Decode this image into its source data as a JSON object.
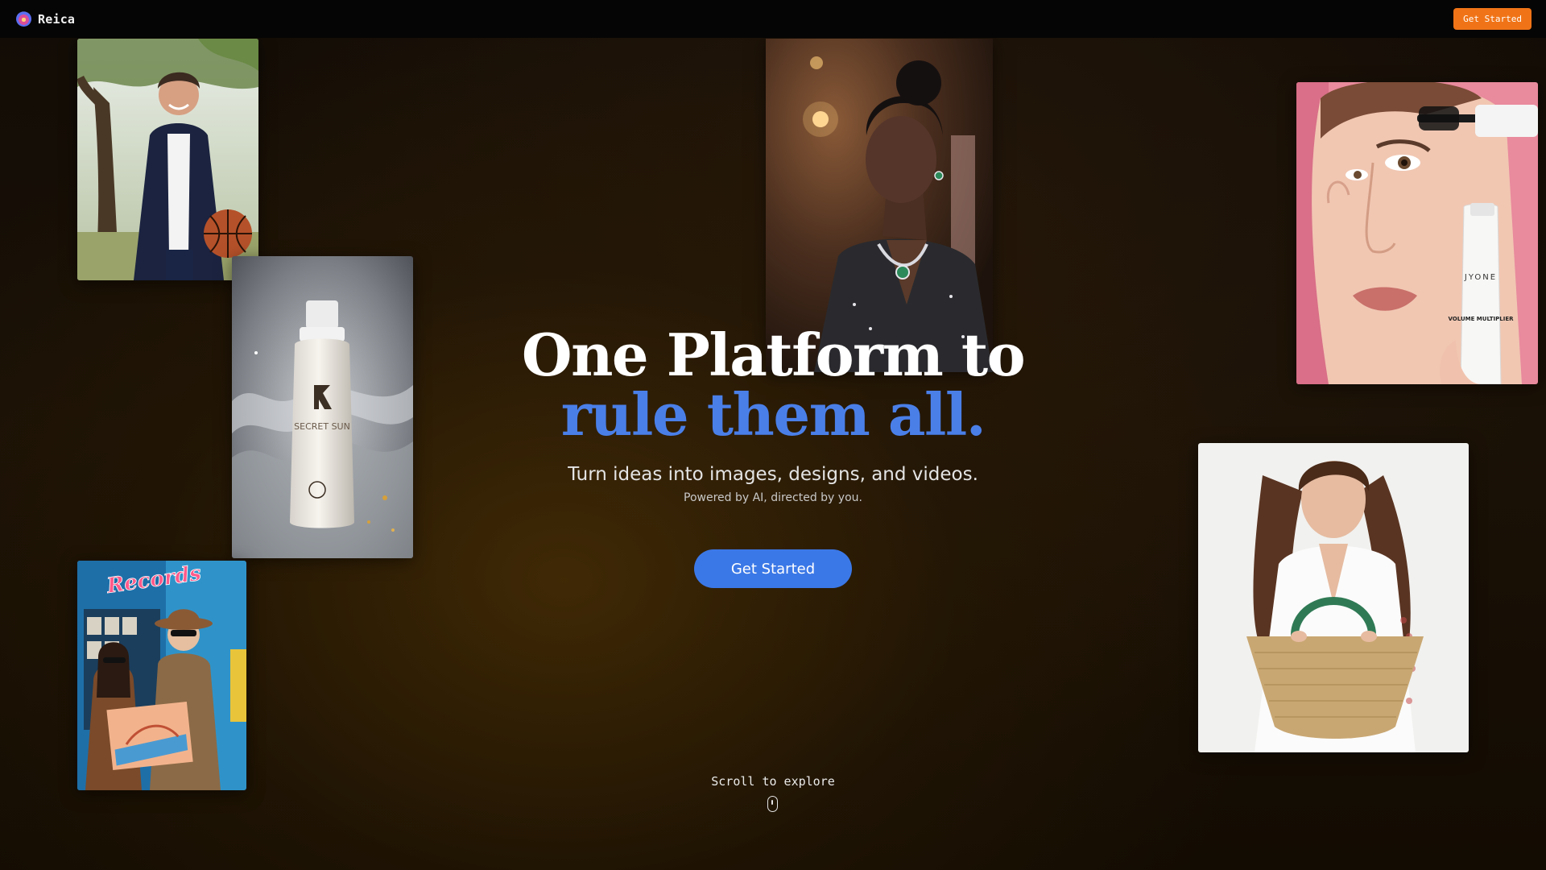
{
  "nav": {
    "brand_name": "Reica",
    "cta_label": "Get Started"
  },
  "hero": {
    "title_line1": "One Platform to",
    "title_line2": "rule them all.",
    "subtitle": "Turn ideas into images, designs, and videos.",
    "tagline": "Powered by AI, directed by you.",
    "cta_label": "Get Started"
  },
  "scroll": {
    "label": "Scroll to explore"
  },
  "gallery": {
    "records_sign": "Records",
    "spray_brand": "SECRET SUN",
    "mascara_brand": "JYONE",
    "mascara_product": "VOLUME MULTIPLIER"
  },
  "colors": {
    "accent_orange": "#f07417",
    "accent_blue": "#3b78e7",
    "headline_blue": "#4a7fe8",
    "nav_background": "#050505"
  }
}
